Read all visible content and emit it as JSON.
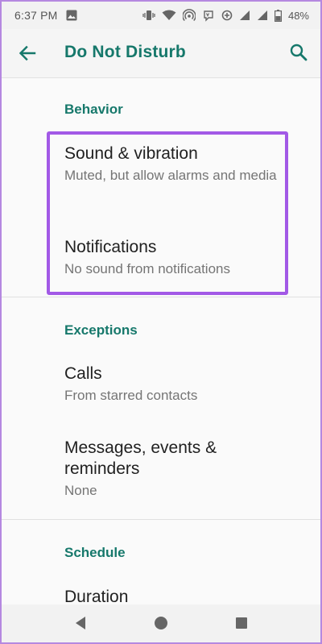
{
  "status_bar": {
    "time": "6:37 PM",
    "battery": "48%",
    "icons": [
      "image-icon",
      "vibrate-icon",
      "wifi-icon",
      "hotspot-icon",
      "volte-icon",
      "data-saver-icon",
      "signal-icon",
      "signal-icon",
      "battery-icon"
    ]
  },
  "app_bar": {
    "title": "Do Not Disturb",
    "back_icon": "arrow-left-icon",
    "search_icon": "search-icon"
  },
  "sections": {
    "behavior": {
      "header": "Behavior",
      "items": [
        {
          "title": "Sound & vibration",
          "summary": "Muted, but allow alarms and media"
        },
        {
          "title": "Notifications",
          "summary": "No sound from notifications"
        }
      ]
    },
    "exceptions": {
      "header": "Exceptions",
      "items": [
        {
          "title": "Calls",
          "summary": "From starred contacts"
        },
        {
          "title": "Messages, events & reminders",
          "summary": "None"
        }
      ]
    },
    "schedule": {
      "header": "Schedule",
      "items": [
        {
          "title": "Duration"
        }
      ]
    }
  },
  "nav_bar": {
    "icons": [
      "back-triangle-icon",
      "home-circle-icon",
      "recents-square-icon"
    ]
  },
  "colors": {
    "accent": "#16786b",
    "highlight": "#a259e6",
    "background": "#fafafa"
  }
}
